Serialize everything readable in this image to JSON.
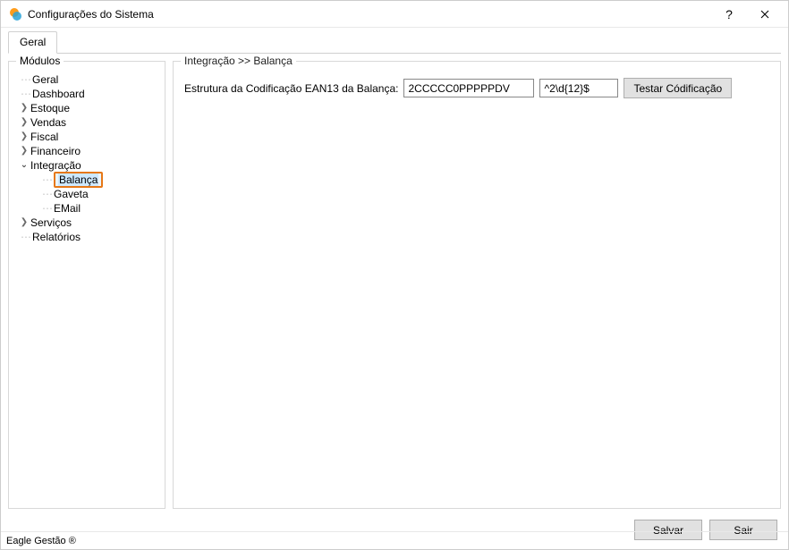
{
  "window": {
    "title": "Configurações do Sistema"
  },
  "tabs": {
    "geral": "Geral"
  },
  "modules": {
    "group_label": "Módulos",
    "items": {
      "geral": "Geral",
      "dashboard": "Dashboard",
      "estoque": "Estoque",
      "vendas": "Vendas",
      "fiscal": "Fiscal",
      "financeiro": "Financeiro",
      "integracao": "Integração",
      "integracao_children": {
        "balanca": "Balança",
        "gaveta": "Gaveta",
        "email": "EMail"
      },
      "servicos": "Serviços",
      "relatorios": "Relatórios"
    }
  },
  "panel": {
    "breadcrumb": "Integração >> Balança",
    "ean_label": "Estrutura da Codificação EAN13 da Balança:",
    "ean_value": "2CCCCC0PPPPPDV",
    "regex_value": "^2\\d{12}$",
    "test_button": "Testar Códificação"
  },
  "actions": {
    "save": "Salvar",
    "exit": "Sair"
  },
  "status": {
    "brand": "Eagle Gestão ®"
  }
}
